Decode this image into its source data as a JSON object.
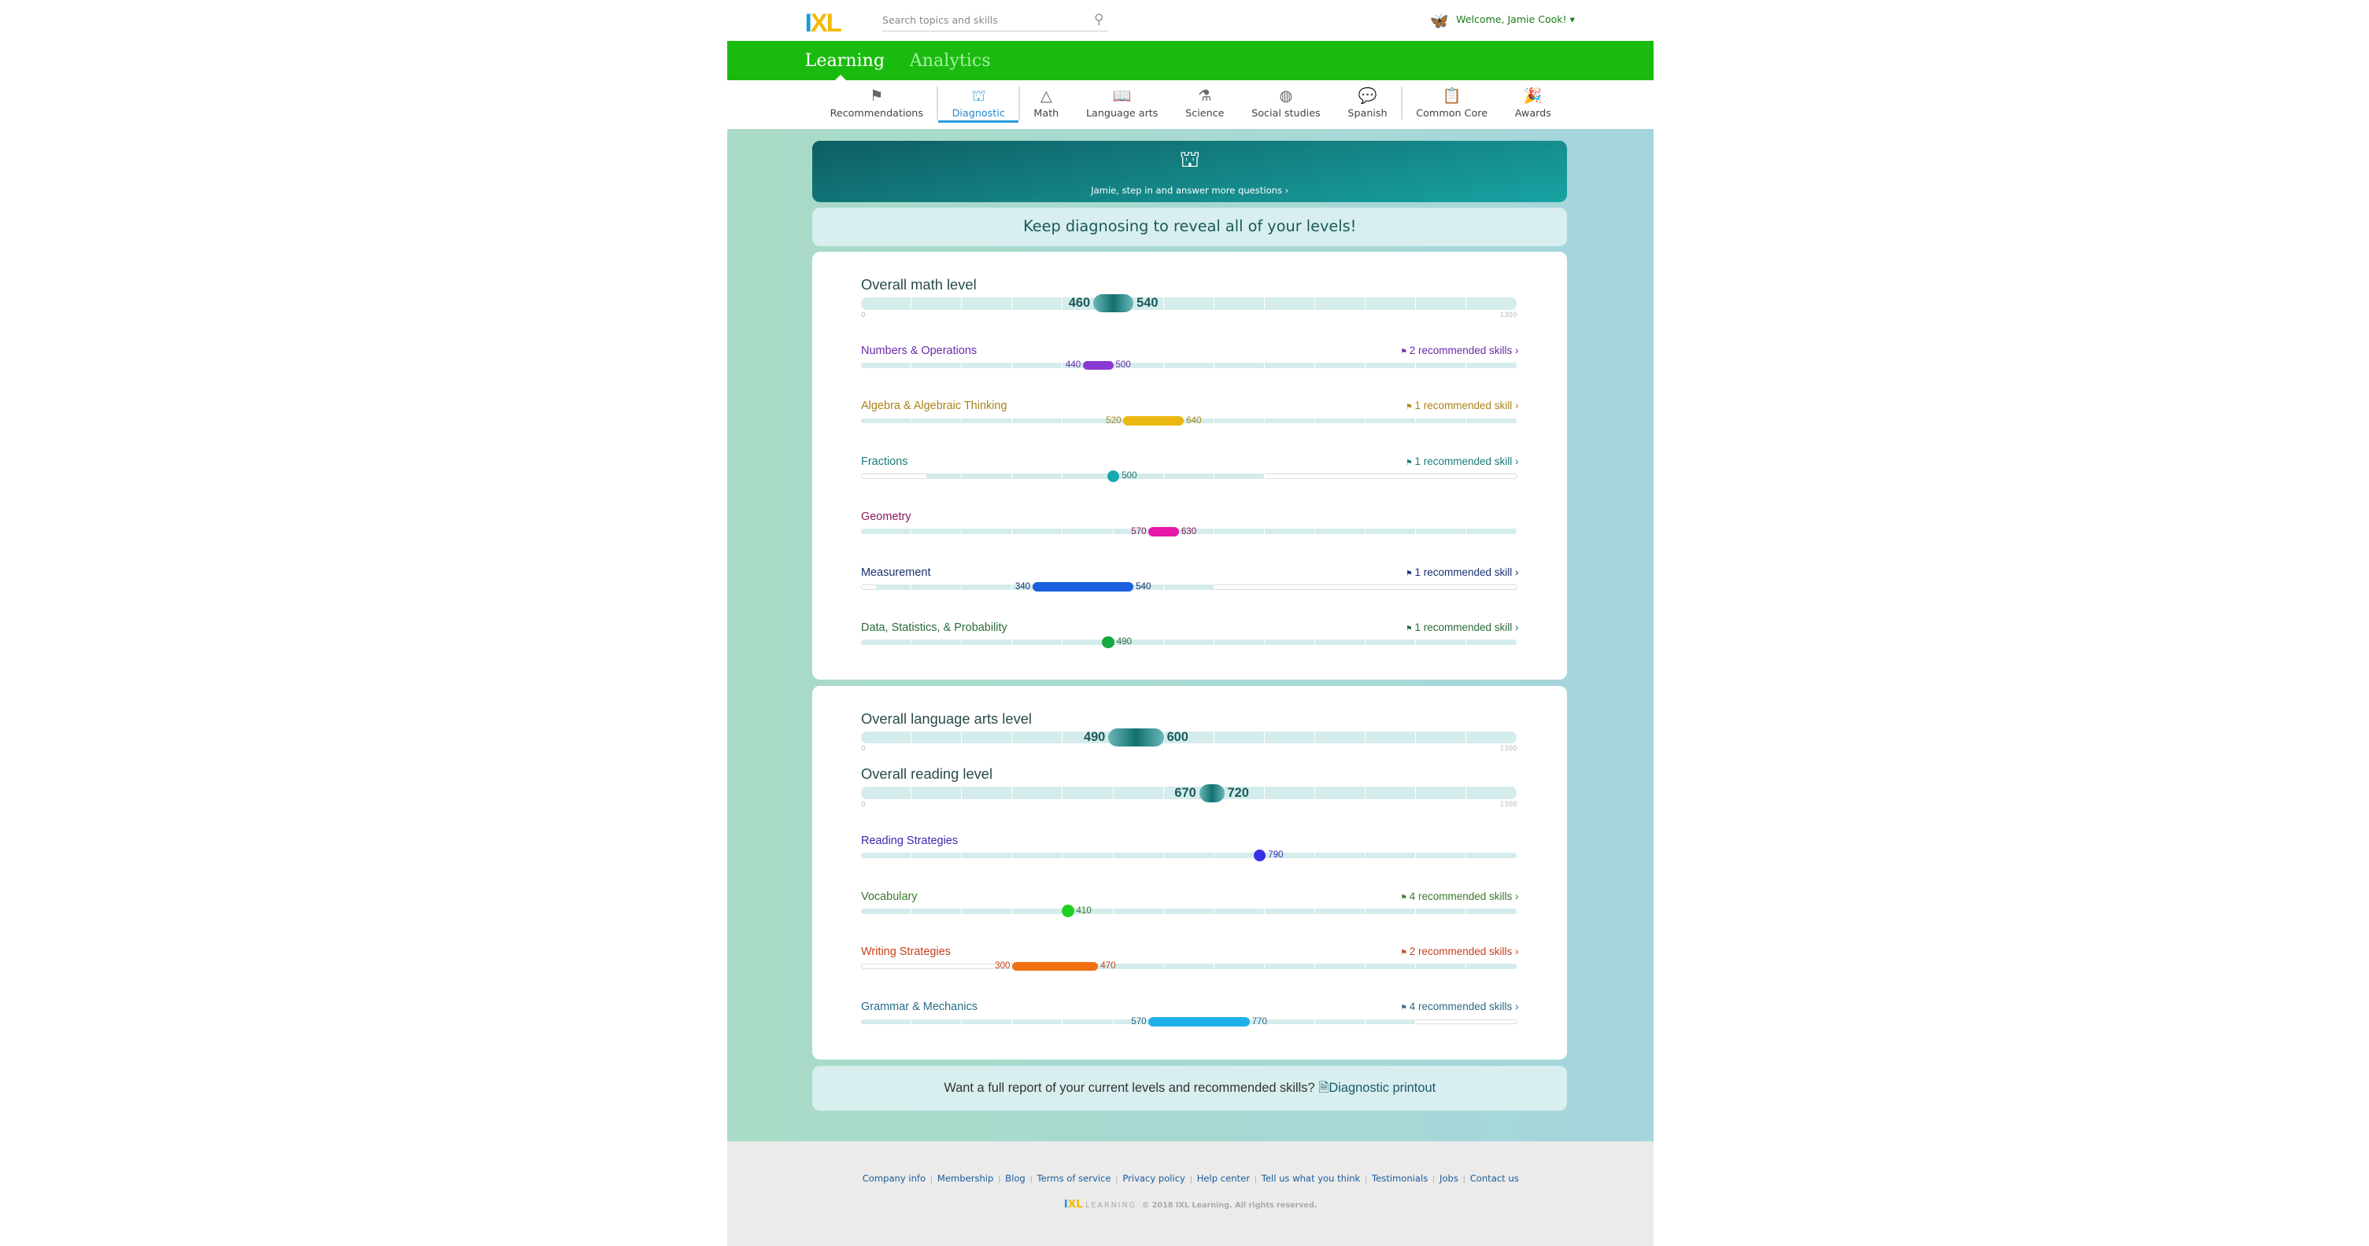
{
  "header": {
    "logo": "IXL",
    "search_placeholder": "Search topics and skills",
    "welcome": "Welcome, Jamie Cook!"
  },
  "main_nav": {
    "tabs": [
      {
        "label": "Learning",
        "active": true
      },
      {
        "label": "Analytics",
        "active": false
      }
    ]
  },
  "sub_nav": {
    "items": [
      {
        "label": "Recommendations",
        "icon": "podium-icon"
      },
      {
        "label": "Diagnostic",
        "icon": "diagnostic-arena-icon",
        "active": true
      },
      {
        "label": "Math",
        "icon": "pyramid-icon"
      },
      {
        "label": "Language arts",
        "icon": "book-icon"
      },
      {
        "label": "Science",
        "icon": "flask-icon"
      },
      {
        "label": "Social studies",
        "icon": "globe-icon"
      },
      {
        "label": "Spanish",
        "icon": "speech-bubbles-icon"
      },
      {
        "label": "Common Core",
        "icon": "clipboard-icon"
      },
      {
        "label": "Awards",
        "icon": "party-horn-icon"
      }
    ]
  },
  "banner": {
    "message": "Jamie, step in and answer more questions ›"
  },
  "keep_message": "Keep diagnosing to reveal all of your levels!",
  "scale": {
    "min": "0",
    "max": "1300"
  },
  "math": {
    "overall": {
      "title": "Overall math level",
      "low": 460,
      "high": 540,
      "low_label": "460",
      "high_label": "540"
    },
    "subjects": [
      {
        "name": "Numbers & Operations",
        "color": "#6a2aa8",
        "bar": "#8a3ad0",
        "low": 440,
        "high": 500,
        "low_label": "440",
        "high_label": "500",
        "rec": "2 recommended skills ›",
        "track": [
          0,
          1300
        ]
      },
      {
        "name": "Algebra & Algebraic Thinking",
        "color": "#a8841a",
        "bar": "#eab810",
        "low": 520,
        "high": 640,
        "low_label": "520",
        "high_label": "640",
        "rec": "1 recommended skill ›",
        "track": [
          0,
          1300
        ]
      },
      {
        "name": "Fractions",
        "color": "#1a7a7a",
        "bar": "#1aa8b0",
        "low": 500,
        "high": 500,
        "low_label": "",
        "high_label": "500",
        "rec": "1 recommended skill ›",
        "track": [
          130,
          800
        ]
      },
      {
        "name": "Geometry",
        "color": "#8a1a5a",
        "bar": "#e818a8",
        "low": 570,
        "high": 630,
        "low_label": "570",
        "high_label": "630",
        "rec": "",
        "track": [
          0,
          1300
        ]
      },
      {
        "name": "Measurement",
        "color": "#1a3070",
        "bar": "#1a60e0",
        "low": 340,
        "high": 540,
        "low_label": "340",
        "high_label": "540",
        "rec": "1 recommended skill ›",
        "track": [
          30,
          700
        ]
      },
      {
        "name": "Data, Statistics, & Probability",
        "color": "#2a6a3a",
        "bar": "#18a840",
        "low": 490,
        "high": 490,
        "low_label": "",
        "high_label": "490",
        "rec": "1 recommended skill ›",
        "track": [
          0,
          1300
        ]
      }
    ]
  },
  "language_arts": {
    "overall": [
      {
        "title": "Overall language arts level",
        "low": 490,
        "high": 600,
        "low_label": "490",
        "high_label": "600"
      },
      {
        "title": "Overall reading level",
        "low": 670,
        "high": 720,
        "low_label": "670",
        "high_label": "720"
      }
    ],
    "subjects": [
      {
        "name": "Reading Strategies",
        "color": "#3a28b0",
        "bar": "#3a30e8",
        "low": 790,
        "high": 790,
        "low_label": "",
        "high_label": "790",
        "rec": "",
        "track": [
          0,
          1300
        ]
      },
      {
        "name": "Vocabulary",
        "color": "#3a7a2a",
        "bar": "#20d020",
        "low": 410,
        "high": 410,
        "low_label": "",
        "high_label": "410",
        "rec": "4 recommended skills ›",
        "track": [
          0,
          1300
        ]
      },
      {
        "name": "Writing Strategies",
        "color": "#c8401a",
        "bar": "#f07012",
        "low": 300,
        "high": 470,
        "low_label": "300",
        "high_label": "470",
        "rec": "2 recommended skills ›",
        "track": [
          300,
          1300
        ]
      },
      {
        "name": "Grammar & Mechanics",
        "color": "#2a6a8a",
        "bar": "#20b0e8",
        "low": 570,
        "high": 770,
        "low_label": "570",
        "high_label": "770",
        "rec": "4 recommended skills ›",
        "track": [
          0,
          1100
        ]
      }
    ]
  },
  "printout": {
    "question": "Want a full report of your current levels and recommended skills?",
    "link": "Diagnostic printout"
  },
  "footer": {
    "links": [
      "Company info",
      "Membership",
      "Blog",
      "Terms of service",
      "Privacy policy",
      "Help center",
      "Tell us what you think",
      "Testimonials",
      "Jobs",
      "Contact us"
    ],
    "copyright": "© 2018 IXL Learning. All rights reserved.",
    "logo": "IXL LEARNING"
  },
  "colors": {
    "green": "#19bb0f",
    "teal": "#137d80"
  }
}
